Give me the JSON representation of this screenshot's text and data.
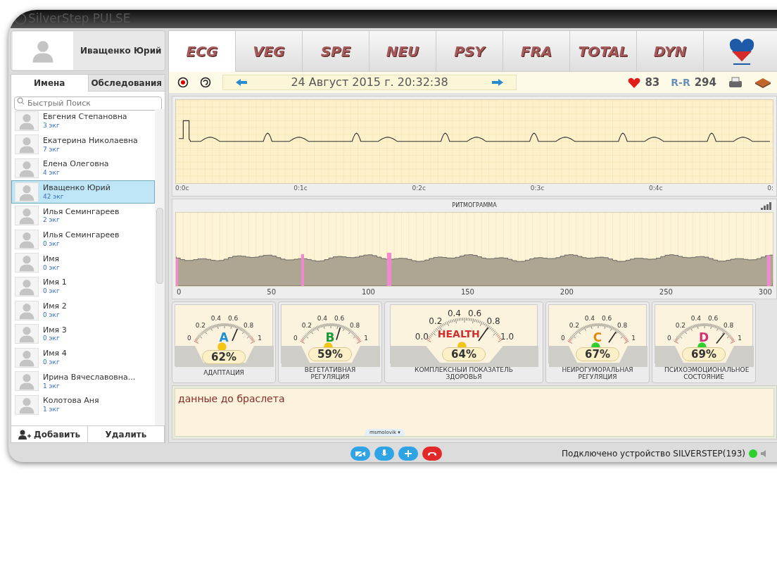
{
  "window": {
    "title": "SilverStep PULSE"
  },
  "profile": {
    "name": "Иващенко Юрий"
  },
  "left_tabs": [
    {
      "label": "Имена",
      "selected": true
    },
    {
      "label": "Обследования",
      "selected": false
    }
  ],
  "search": {
    "placeholder": "Быстрый Поиск"
  },
  "patients": [
    {
      "name": "Евгения Степановна",
      "count": "3 экг",
      "selected": false
    },
    {
      "name": "Екатерина Николаевна",
      "count": "7 экг",
      "selected": false
    },
    {
      "name": "Елена Олеговна",
      "count": "4 экг",
      "selected": false
    },
    {
      "name": "Иващенко Юрий",
      "count": "42 экг",
      "selected": true
    },
    {
      "name": "Илья Семингареев",
      "count": "2 экг",
      "selected": false
    },
    {
      "name": "Илья Семингареев",
      "count": "0 экг",
      "selected": false
    },
    {
      "name": "Имя",
      "count": "0 экг",
      "selected": false
    },
    {
      "name": "Имя 1",
      "count": "0 экг",
      "selected": false
    },
    {
      "name": "Имя 2",
      "count": "0 экг",
      "selected": false
    },
    {
      "name": "Имя 3",
      "count": "0 экг",
      "selected": false
    },
    {
      "name": "Имя 4",
      "count": "0 экг",
      "selected": false
    },
    {
      "name": "Ирина Вячеславовна...",
      "count": "1 экг",
      "selected": false
    },
    {
      "name": "Колотова Аня",
      "count": "1 экг",
      "selected": false
    }
  ],
  "left_buttons": [
    "Добавить",
    "Удалить"
  ],
  "modes": [
    {
      "label": "ECG",
      "selected": true
    },
    {
      "label": "VEG",
      "selected": false
    },
    {
      "label": "SPE",
      "selected": false
    },
    {
      "label": "NEU",
      "selected": false
    },
    {
      "label": "PSY",
      "selected": false
    },
    {
      "label": "FRA",
      "selected": false
    },
    {
      "label": "TOTAL",
      "selected": false
    },
    {
      "label": "DYN",
      "selected": false
    }
  ],
  "toolbar": {
    "date": "24 Август 2015 г. 20:32:38",
    "heart_rate": "83",
    "rr_label": "R-R",
    "rr_value": "294"
  },
  "ecg": {
    "ticks": [
      "0:0c",
      "0:1c",
      "0:2c",
      "0:3c",
      "0:4c",
      "0:"
    ]
  },
  "rhythmogram": {
    "title": "РИТМОГРАММА",
    "ticks": [
      "0",
      "50",
      "100",
      "150",
      "200",
      "250",
      "300"
    ]
  },
  "gauges": [
    {
      "kind": "small",
      "letter": "A",
      "color": "#1e90d6",
      "normal": false,
      "level": 0.62,
      "percent": "62%",
      "label": "АДАПТАЦИЯ",
      "scale": [
        "0",
        "0.2",
        "0.4",
        "0.6",
        "0.8",
        "1"
      ]
    },
    {
      "kind": "small",
      "letter": "B",
      "color": "#1a9a3a",
      "normal": false,
      "level": 0.59,
      "percent": "59%",
      "label": "ВЕГЕТАТИВНАЯ РЕГУЛЯЦИЯ",
      "scale": [
        "0",
        "0.2",
        "0.4",
        "0.6",
        "0.8",
        "1"
      ]
    },
    {
      "kind": "large",
      "letter": "HEALTH",
      "color": "#d03030",
      "normal": false,
      "level": 0.64,
      "percent": "64%",
      "label": "КОМПЛЕКСНЫЙ ПОКАЗАТЕЛЬ ЗДОРОВЬЯ",
      "scale": [
        "0.0",
        "0.2",
        "0.4",
        "0.6",
        "0.8",
        "1.0"
      ]
    },
    {
      "kind": "small",
      "letter": "C",
      "color": "#e08a10",
      "normal": true,
      "level": 0.67,
      "percent": "67%",
      "label": "НЕЙРОГУМОРАЛЬНАЯ РЕГУЛЯЦИЯ",
      "scale": [
        "0",
        "0.2",
        "0.4",
        "0.6",
        "0.8",
        "1"
      ]
    },
    {
      "kind": "small",
      "letter": "D",
      "color": "#d0307a",
      "normal": true,
      "level": 0.69,
      "percent": "69%",
      "label": "ПСИХОЭМОЦИОНАЛЬНОЕ СОСТОЯНИЕ",
      "scale": [
        "0",
        "0.2",
        "0.4",
        "0.6",
        "0.8",
        "1"
      ]
    }
  ],
  "notes": {
    "text": "данные до браслета",
    "user": "msmolovik",
    "user_caret": "▾"
  },
  "status": {
    "text": "Подключено устройство SILVERSTEP(193)",
    "connected": true
  }
}
